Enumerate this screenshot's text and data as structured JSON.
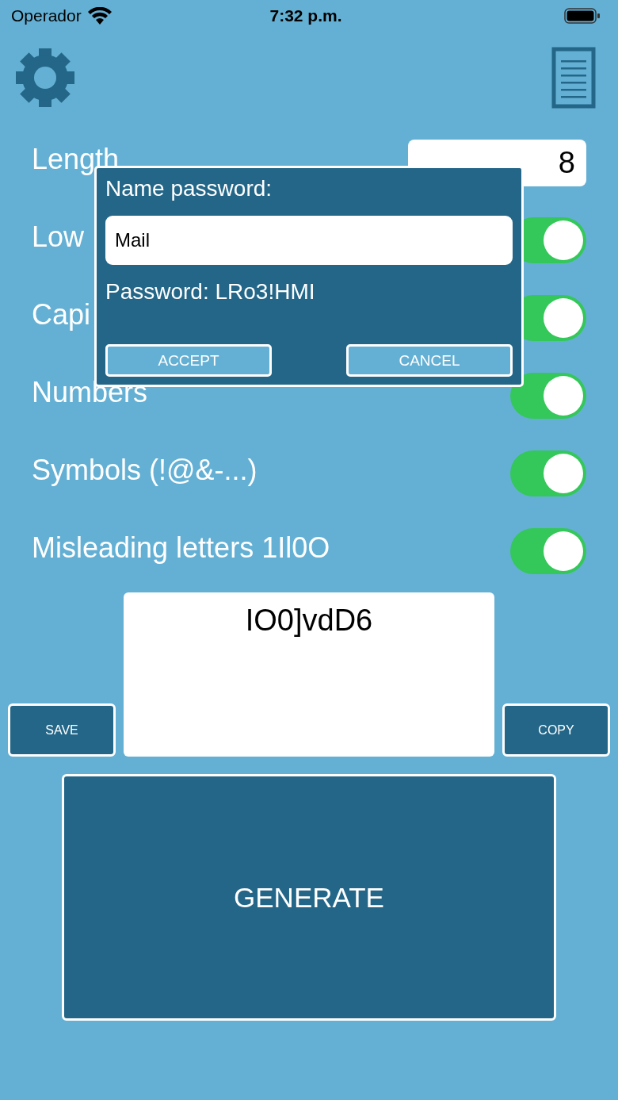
{
  "status_bar": {
    "carrier": "Operador",
    "time": "7:32 p.m."
  },
  "length": {
    "label": "Length",
    "value": "8"
  },
  "options": [
    {
      "label": "Low",
      "on": true
    },
    {
      "label": "Capi",
      "on": true
    },
    {
      "label": "Numbers",
      "on": true
    },
    {
      "label": "Symbols (!@&-...)",
      "on": true
    },
    {
      "label": "Misleading letters 1Il0O",
      "on": true
    }
  ],
  "output": {
    "password": "IO0]vdD6"
  },
  "buttons": {
    "save": "SAVE",
    "copy": "COPY",
    "generate": "GENERATE"
  },
  "dialog": {
    "title": "Name password:",
    "name_value": "Mail",
    "password_line": "Password: LRo3!HMI",
    "accept": "ACCEPT",
    "cancel": "CANCEL"
  }
}
